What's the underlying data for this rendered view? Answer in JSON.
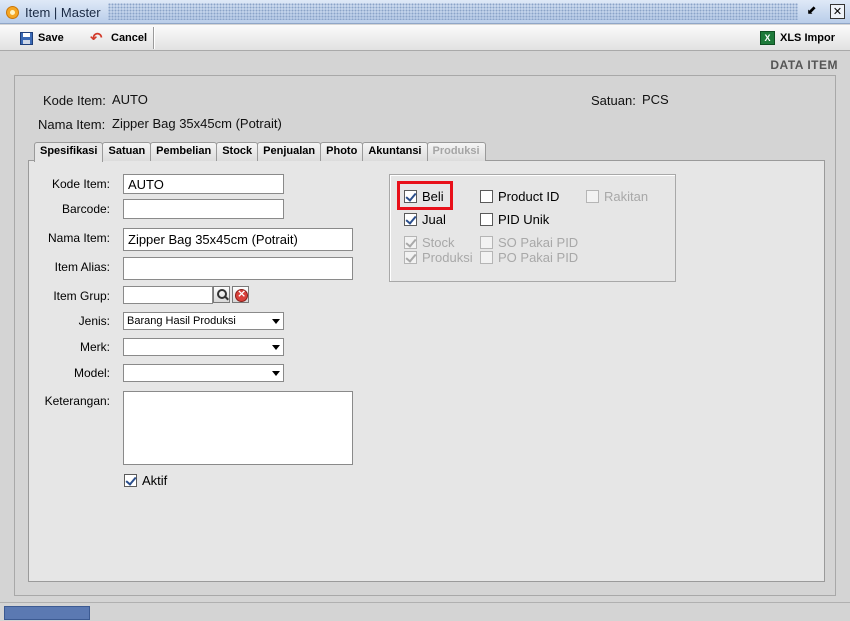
{
  "window": {
    "title": "Item | Master",
    "restore_glyph": "⬋",
    "close_glyph": "✕"
  },
  "toolbar": {
    "save_label": "Save",
    "cancel_label": "Cancel",
    "import_label": "XLS Impor",
    "xls_icon_text": "X"
  },
  "section_title": "DATA ITEM",
  "header": {
    "kode_label": "Kode Item:",
    "kode_value": "AUTO",
    "nama_label": "Nama Item:",
    "nama_value": "Zipper Bag 35x45cm (Potrait)",
    "satuan_label": "Satuan:",
    "satuan_value": "PCS"
  },
  "tabs": [
    {
      "label": "Spesifikasi",
      "active": true
    },
    {
      "label": "Satuan"
    },
    {
      "label": "Pembelian"
    },
    {
      "label": "Stock"
    },
    {
      "label": "Penjualan"
    },
    {
      "label": "Photo"
    },
    {
      "label": "Akuntansi"
    },
    {
      "label": "Produksi",
      "disabled": true
    }
  ],
  "form": {
    "kode_label": "Kode Item:",
    "kode_value": "AUTO",
    "barcode_label": "Barcode:",
    "barcode_value": "",
    "nama_label": "Nama Item:",
    "nama_value": "Zipper Bag 35x45cm (Potrait)",
    "alias_label": "Item Alias:",
    "alias_value": "",
    "grup_label": "Item Grup:",
    "grup_value": "",
    "jenis_label": "Jenis:",
    "jenis_value": "Barang Hasil Produksi",
    "merk_label": "Merk:",
    "merk_value": "",
    "model_label": "Model:",
    "model_value": "",
    "keterangan_label": "Keterangan:",
    "keterangan_value": "",
    "aktif_label": "Aktif",
    "aktif_checked": true
  },
  "options": {
    "beli": {
      "label": "Beli",
      "checked": true,
      "enabled": true
    },
    "jual": {
      "label": "Jual",
      "checked": true,
      "enabled": true
    },
    "stock": {
      "label": "Stock",
      "checked": true,
      "enabled": false
    },
    "produksi": {
      "label": "Produksi",
      "checked": true,
      "enabled": false
    },
    "product_id": {
      "label": "Product ID",
      "checked": false,
      "enabled": true
    },
    "pid_unik": {
      "label": "PID Unik",
      "checked": false,
      "enabled": true
    },
    "so_pakai_pid": {
      "label": "SO Pakai PID",
      "checked": false,
      "enabled": false
    },
    "po_pakai_pid": {
      "label": "PO Pakai PID",
      "checked": false,
      "enabled": false
    },
    "rakitan": {
      "label": "Rakitan",
      "checked": false,
      "enabled": false
    }
  },
  "colors": {
    "highlight": "#e8101a",
    "title_bar": "#c8d8ef",
    "panel_bg": "#e6e6e6"
  },
  "icons": {
    "app": "app-logo-icon",
    "save": "floppy-disk-icon",
    "cancel": "undo-arrow-icon",
    "xls": "excel-icon",
    "search": "magnifier-icon",
    "clear": "clear-icon"
  }
}
